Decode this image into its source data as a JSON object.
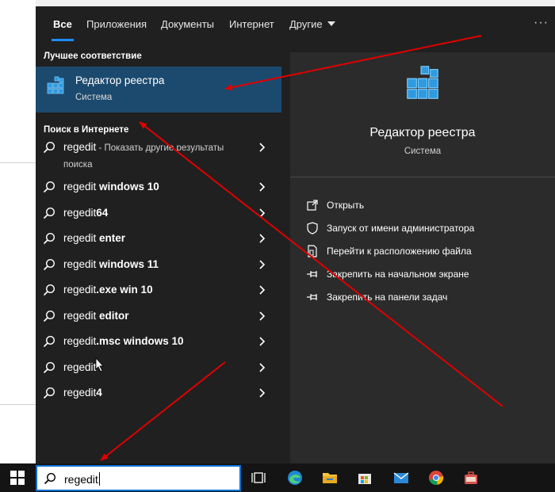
{
  "tabs": [
    {
      "label": "Все",
      "active": true
    },
    {
      "label": "Приложения",
      "active": false
    },
    {
      "label": "Документы",
      "active": false
    },
    {
      "label": "Интернет",
      "active": false
    },
    {
      "label": "Другие",
      "active": false
    }
  ],
  "more_label": "···",
  "best_match": {
    "header": "Лучшее соответствие",
    "title": "Редактор реестра",
    "subtitle": "Система",
    "icon": "registry-editor-icon"
  },
  "web": {
    "header": "Поиск в Интернете",
    "results": [
      {
        "query": "regedit",
        "rest": " - Показать другие результаты поиска"
      },
      {
        "query": "regedit ",
        "bold": "windows 10"
      },
      {
        "query": "regedit",
        "bold": "64"
      },
      {
        "query": "regedit ",
        "bold": "enter"
      },
      {
        "query": "regedit ",
        "bold": "windows 11"
      },
      {
        "query": "regedit",
        "bold": ".exe win 10"
      },
      {
        "query": "regedit ",
        "bold": "editor"
      },
      {
        "query": "regedit",
        "bold": ".msc windows 10"
      },
      {
        "query": "regedit",
        "bold": ""
      },
      {
        "query": "regedit",
        "bold": "4"
      }
    ]
  },
  "preview": {
    "title": "Редактор реестра",
    "subtitle": "Система",
    "actions": [
      {
        "label": "Открыть",
        "icon": "open-icon"
      },
      {
        "label": "Запуск от имени администратора",
        "icon": "shield-icon"
      },
      {
        "label": "Перейти к расположению файла",
        "icon": "file-location-icon"
      },
      {
        "label": "Закрепить на начальном экране",
        "icon": "pin-icon"
      },
      {
        "label": "Закрепить на панели задач",
        "icon": "pin-icon"
      }
    ]
  },
  "taskbar": {
    "search_value": "regedit",
    "apps": [
      "task-view-icon",
      "edge-icon",
      "file-explorer-icon",
      "store-icon",
      "mail-icon",
      "chrome-icon",
      "briefcase-icon"
    ]
  },
  "colors": {
    "panel_bg": "#202020",
    "preview_bg": "#2b2b2b",
    "selected_bg": "#1c4a6e",
    "accent": "#1a8cff",
    "arrow": "#e00000"
  }
}
